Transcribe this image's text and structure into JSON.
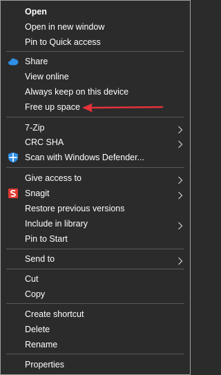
{
  "menu": {
    "items": [
      {
        "label": "Open"
      },
      {
        "label": "Open in new window"
      },
      {
        "label": "Pin to Quick access"
      },
      {
        "label": "Share",
        "icon": "onedrive-cloud-icon"
      },
      {
        "label": "View online"
      },
      {
        "label": "Always keep on this device"
      },
      {
        "label": "Free up space"
      },
      {
        "label": "7-Zip",
        "submenu": true
      },
      {
        "label": "CRC SHA",
        "submenu": true
      },
      {
        "label": "Scan with Windows Defender...",
        "icon": "windows-defender-shield-icon"
      },
      {
        "label": "Give access to",
        "submenu": true
      },
      {
        "label": "Snagit",
        "icon": "snagit-icon",
        "submenu": true
      },
      {
        "label": "Restore previous versions"
      },
      {
        "label": "Include in library",
        "submenu": true
      },
      {
        "label": "Pin to Start"
      },
      {
        "label": "Send to",
        "submenu": true
      },
      {
        "label": "Cut"
      },
      {
        "label": "Copy"
      },
      {
        "label": "Create shortcut"
      },
      {
        "label": "Delete"
      },
      {
        "label": "Rename"
      },
      {
        "label": "Properties"
      }
    ],
    "annotation": {
      "icon": "red-arrow-icon",
      "color": "#e5323c"
    }
  },
  "colors": {
    "background": "#2b2b2b",
    "text": "#ffffff",
    "separator": "#5a5a5a",
    "accent_blue": "#2f8fe6",
    "snagit_red": "#e03c31"
  }
}
